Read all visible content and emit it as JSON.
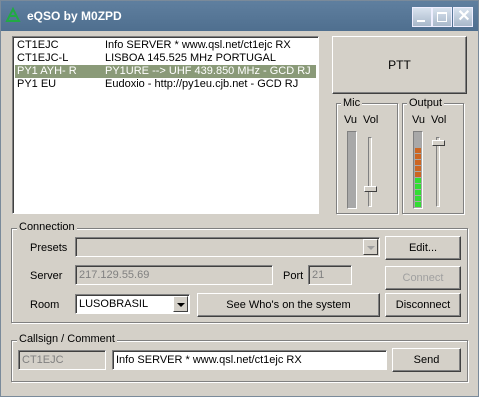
{
  "window": {
    "title": "eQSO by M0ZPD",
    "app_icon": "antenna-icon"
  },
  "users": [
    {
      "call": "CT1EJC",
      "info": "Info SERVER *      www.qsl.net/ct1ejc    RX",
      "selected": false
    },
    {
      "call": "CT1EJC-L",
      "info": "LISBOA    145.525 MHz      PORTUGAL",
      "selected": false
    },
    {
      "call": "PY1 AYH- R",
      "info": "PY1URE --> UHF 439.850 MHz  - GCD RJ",
      "selected": true
    },
    {
      "call": "PY1 EU",
      "info": "Eudoxio - http://py1eu.cjb.net - GCD RJ",
      "selected": false
    }
  ],
  "ptt": {
    "label": "PTT"
  },
  "mic": {
    "title": "Mic",
    "vu_label": "Vu",
    "vol_label": "Vol",
    "level": 0,
    "volume": 0.25
  },
  "output": {
    "title": "Output",
    "vu_label": "Vu",
    "vol_label": "Vol",
    "level": 0.75,
    "volume": 0.9
  },
  "colors": {
    "selection": "#8a9a78",
    "meter_green": "#33dd33",
    "meter_orange": "#cc6622",
    "titlebar": "#5f7f9f"
  },
  "connection": {
    "title": "Connection",
    "presets_label": "Presets",
    "presets_value": "",
    "edit_label": "Edit...",
    "server_label": "Server",
    "server_value": "217.129.55.69",
    "port_label": "Port",
    "port_value": "21",
    "connect_label": "Connect",
    "room_label": "Room",
    "room_value": "LUSOBRASIL",
    "whos_on_label": "See Who's on the system",
    "disconnect_label": "Disconnect"
  },
  "callsign": {
    "title": "Callsign / Comment",
    "callsign_value": "CT1EJC",
    "comment_value": "Info SERVER *      www.qsl.net/ct1ejc    RX",
    "send_label": "Send"
  }
}
